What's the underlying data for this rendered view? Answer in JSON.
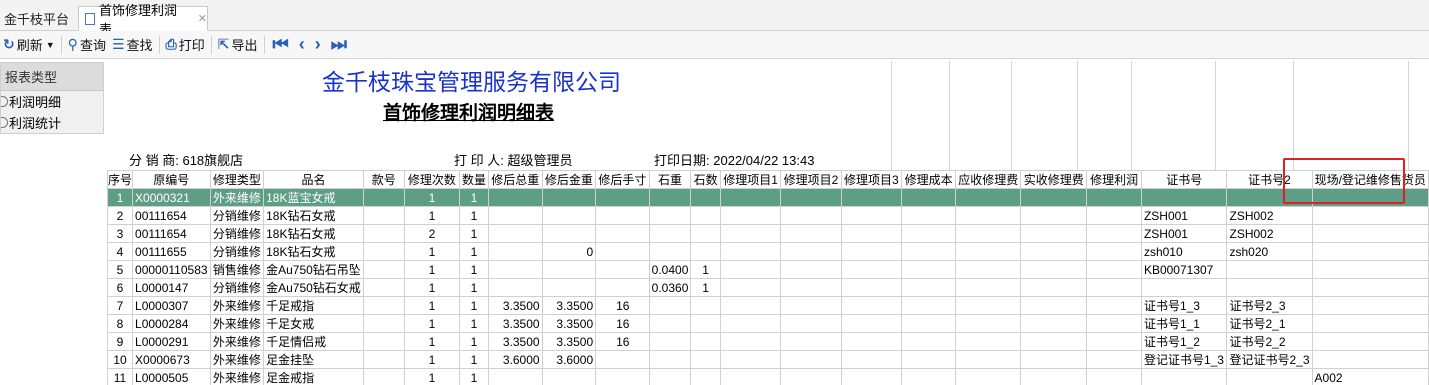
{
  "tabs": {
    "home": "金千枝平台",
    "active": "首饰修理利润表",
    "close": "✕"
  },
  "toolbar": {
    "refresh": "刷新",
    "query": "查询",
    "find": "查找",
    "print": "打印",
    "export": "导出"
  },
  "left_panel": {
    "title": "报表类型",
    "items": [
      "利润明细",
      "利润统计"
    ]
  },
  "report": {
    "company": "金千枝珠宝管理服务有限公司",
    "title": "首饰修理利润明细表",
    "distributor_label": "分 销 商:",
    "distributor": "618旗舰店",
    "printer_label": "打 印 人:",
    "printer": "超级管理员",
    "print_date_label": "打印日期:",
    "print_date": "2022/04/22 13:43"
  },
  "columns": [
    "序号",
    "原编号",
    "修理类型",
    "品名",
    "款号",
    "修理次数",
    "数量",
    "修后总重",
    "修后金重",
    "修后手寸",
    "石重",
    "石数",
    "修理项目1",
    "修理项目2",
    "修理项目3",
    "修理成本",
    "应收修理费",
    "实收修理费",
    "修理利润",
    "证书号",
    "证书号2",
    "现场/登记维修售货员"
  ],
  "rows": [
    [
      "1",
      "X0000321",
      "外来维修",
      "18K蓝宝女戒",
      "",
      "1",
      "1",
      "",
      "",
      "",
      "",
      "",
      "",
      "",
      "",
      "",
      "",
      "",
      "",
      "",
      "",
      ""
    ],
    [
      "2",
      "00111654",
      "分销维修",
      "18K钻石女戒",
      "",
      "1",
      "1",
      "",
      "",
      "",
      "",
      "",
      "",
      "",
      "",
      "",
      "",
      "",
      "",
      "ZSH001",
      "ZSH002",
      ""
    ],
    [
      "3",
      "00111654",
      "分销维修",
      "18K钻石女戒",
      "",
      "2",
      "1",
      "",
      "",
      "",
      "",
      "",
      "",
      "",
      "",
      "",
      "",
      "",
      "",
      "ZSH001",
      "ZSH002",
      ""
    ],
    [
      "4",
      "00111655",
      "分销维修",
      "18K钻石女戒",
      "",
      "1",
      "1",
      "",
      "0",
      "",
      "",
      "",
      "",
      "",
      "",
      "",
      "",
      "",
      "",
      "zsh010",
      "zsh020",
      ""
    ],
    [
      "5",
      "00000110583",
      "销售维修",
      "金Au750钻石吊坠",
      "",
      "1",
      "1",
      "",
      "",
      "",
      "0.0400",
      "1",
      "",
      "",
      "",
      "",
      "",
      "",
      "",
      "KB00071307",
      "",
      ""
    ],
    [
      "6",
      "L0000147",
      "分销维修",
      "金Au750钻石女戒",
      "",
      "1",
      "1",
      "",
      "",
      "",
      "0.0360",
      "1",
      "",
      "",
      "",
      "",
      "",
      "",
      "",
      "",
      "",
      ""
    ],
    [
      "7",
      "L0000307",
      "外来维修",
      "千足戒指",
      "",
      "1",
      "1",
      "3.3500",
      "3.3500",
      "16",
      "",
      "",
      "",
      "",
      "",
      "",
      "",
      "",
      "",
      "证书号1_3",
      "证书号2_3",
      ""
    ],
    [
      "8",
      "L0000284",
      "外来维修",
      "千足女戒",
      "",
      "1",
      "1",
      "3.3500",
      "3.3500",
      "16",
      "",
      "",
      "",
      "",
      "",
      "",
      "",
      "",
      "",
      "证书号1_1",
      "证书号2_1",
      ""
    ],
    [
      "9",
      "L0000291",
      "外来维修",
      "千足情侣戒",
      "",
      "1",
      "1",
      "3.3500",
      "3.3500",
      "16",
      "",
      "",
      "",
      "",
      "",
      "",
      "",
      "",
      "",
      "证书号1_2",
      "证书号2_2",
      ""
    ],
    [
      "10",
      "X0000673",
      "外来维修",
      "足金挂坠",
      "",
      "1",
      "1",
      "3.6000",
      "3.6000",
      "",
      "",
      "",
      "",
      "",
      "",
      "",
      "",
      "",
      "",
      "登记证书号1_3",
      "登记证书号2_3",
      ""
    ],
    [
      "11",
      "L0000505",
      "外来维修",
      "足金戒指",
      "",
      "1",
      "1",
      "",
      "",
      "",
      "",
      "",
      "",
      "",
      "",
      "",
      "",
      "",
      "",
      "",
      "",
      "A002"
    ]
  ],
  "selected_row": 0
}
